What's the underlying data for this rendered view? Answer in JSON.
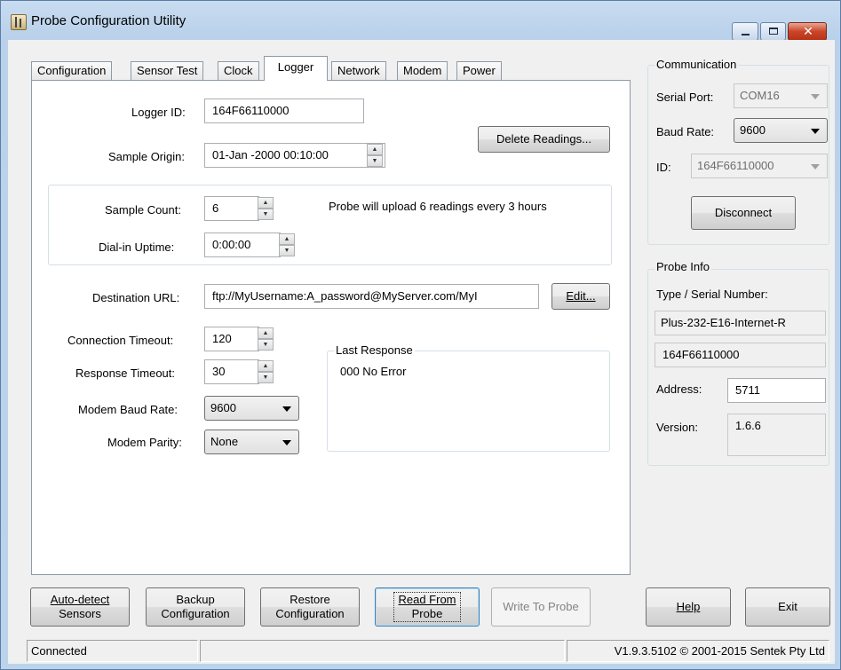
{
  "window": {
    "title": "Probe Configuration Utility"
  },
  "tabs": [
    {
      "label": "Configuration"
    },
    {
      "label": "Sensor Test"
    },
    {
      "label": "Clock"
    },
    {
      "label": "Logger"
    },
    {
      "label": "Network"
    },
    {
      "label": "Modem"
    },
    {
      "label": "Power"
    }
  ],
  "logger": {
    "logger_id_label": "Logger ID:",
    "logger_id_value": "164F66110000",
    "sample_origin_label": "Sample Origin:",
    "sample_origin_value": "01-Jan -2000 00:10:00",
    "delete_readings_label": "Delete Readings...",
    "sample_count_label": "Sample Count:",
    "sample_count_value": "6",
    "upload_info": "Probe will upload 6 readings every 3 hours",
    "dialin_label": "Dial-in Uptime:",
    "dialin_value": "0:00:00",
    "destination_url_label": "Destination URL:",
    "destination_url_value": "ftp://MyUsername:A_password@MyServer.com/MyI",
    "edit_label": "Edit...",
    "connection_timeout_label": "Connection Timeout:",
    "connection_timeout_value": "120",
    "response_timeout_label": "Response Timeout:",
    "response_timeout_value": "30",
    "modem_baud_label": "Modem Baud Rate:",
    "modem_baud_value": "9600",
    "modem_parity_label": "Modem Parity:",
    "modem_parity_value": "None",
    "last_response_title": "Last Response",
    "last_response_value": "000 No Error"
  },
  "communication": {
    "title": "Communication",
    "serial_port_label": "Serial Port:",
    "serial_port_value": "COM16",
    "baud_rate_label": "Baud Rate:",
    "baud_rate_value": "9600",
    "id_label": "ID:",
    "id_value": "164F66110000",
    "disconnect_label": "Disconnect"
  },
  "probe_info": {
    "title": "Probe Info",
    "type_serial_label": "Type / Serial Number:",
    "type_value": "Plus-232-E16-Internet-R",
    "serial_value": "164F66110000",
    "address_label": "Address:",
    "address_value": "5711",
    "version_label": "Version:",
    "version_value": "1.6.6"
  },
  "bottom_buttons": {
    "autodetect_line1": "Auto-detect",
    "autodetect_line2": "Sensors",
    "backup_line1": "Backup",
    "backup_line2": "Configuration",
    "restore_line1": "Restore",
    "restore_line2": "Configuration",
    "read_line1": "Read From",
    "read_line2": "Probe",
    "write_label": "Write To Probe",
    "help_label": "Help",
    "exit_label": "Exit"
  },
  "status": {
    "connection": "Connected",
    "middle": "",
    "version": "V1.9.3.5102 © 2001-2015 Sentek Pty Ltd"
  }
}
